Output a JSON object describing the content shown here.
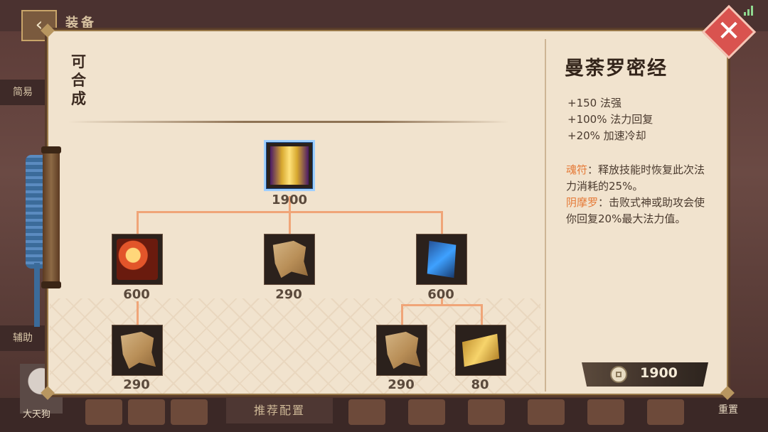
{
  "background": {
    "header_title": "装备",
    "back_glyph": "‹",
    "side_buttons": [
      "简易",
      "辅助"
    ],
    "recommend_label": "推荐配置",
    "hero_name": "大天狗",
    "reset_label": "重置"
  },
  "panel": {
    "section_label": "可合成",
    "close_glyph": "✕"
  },
  "tree": {
    "root": {
      "icon": "mandala-scroll-icon",
      "cost": "1900"
    },
    "level2": [
      {
        "icon": "red-book-icon",
        "cost": "600"
      },
      {
        "icon": "paper-scroll-icon",
        "cost": "290"
      },
      {
        "icon": "blue-talisman-icon",
        "cost": "600"
      }
    ],
    "level3": [
      {
        "icon": "paper-scroll-icon",
        "cost": "290"
      },
      {
        "icon": "paper-scroll-icon",
        "cost": "290"
      },
      {
        "icon": "gold-ticket-icon",
        "cost": "80"
      }
    ]
  },
  "detail": {
    "name": "曼荼罗密经",
    "stats": [
      "+150 法强",
      "+100% 法力回复",
      "+20% 加速冷却"
    ],
    "passives": [
      {
        "keyword": "魂符",
        "text": "：释放技能时恢复此次法力消耗的25%。"
      },
      {
        "keyword": "阴摩罗",
        "text": "：击败式神或助攻会使你回复20%最大法力值。"
      }
    ],
    "price": "1900",
    "price_icon": "coin-icon"
  },
  "colors": {
    "panel_bg": "#f1e3ce",
    "connector": "#f0a578",
    "keyword": "#e57936",
    "close": "#d9534f"
  }
}
